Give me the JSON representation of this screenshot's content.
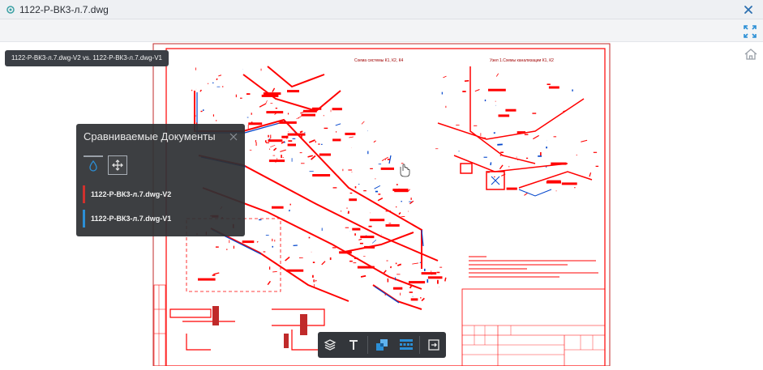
{
  "window": {
    "title": "1122-Р-ВК3-л.7.dwg"
  },
  "tooltip": {
    "text": "1122-Р-ВК3-л.7.dwg-V2  vs.  1122-Р-ВК3-л.7.dwg-V1"
  },
  "panel": {
    "title": "Сравниваемые Документы",
    "documents": [
      {
        "label": "1122-Р-ВК3-л.7.dwg-V2",
        "color": "#d0312d"
      },
      {
        "label": "1122-Р-ВК3-л.7.dwg-V1",
        "color": "#2b8fd6"
      }
    ]
  },
  "drawing": {
    "note_top": "Схема системы К1, К2, К4",
    "note_right": "Узел 1.Схемы канализации К1, К2"
  },
  "colors": {
    "accent": "#2b8fd6",
    "drawing_red": "#ff0000",
    "panel_bg": "#2e3034"
  }
}
